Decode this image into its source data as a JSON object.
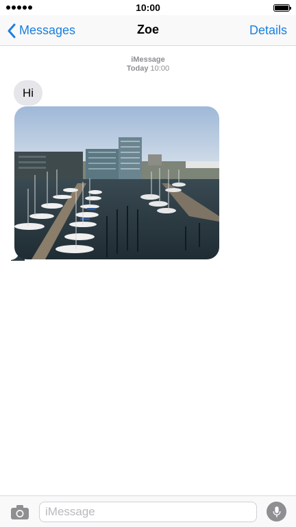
{
  "status_bar": {
    "time": "10:00",
    "signal_icon": "signal-dots-icon",
    "battery_icon": "battery-full-icon"
  },
  "nav": {
    "back_label": "Messages",
    "back_icon": "chevron-left-icon",
    "title": "Zoe",
    "details_label": "Details",
    "accent_color": "#1a7fe0"
  },
  "conversation": {
    "service": "iMessage",
    "date_day": "Today",
    "date_time": "10:00",
    "messages": [
      {
        "type": "text",
        "text": "Hi",
        "bubble_color": "#e5e5ea"
      },
      {
        "type": "photo",
        "subject": "marina-harbour-photo"
      }
    ]
  },
  "input_bar": {
    "camera_icon": "camera-icon",
    "placeholder": "iMessage",
    "value": "",
    "mic_icon": "microphone-icon"
  }
}
